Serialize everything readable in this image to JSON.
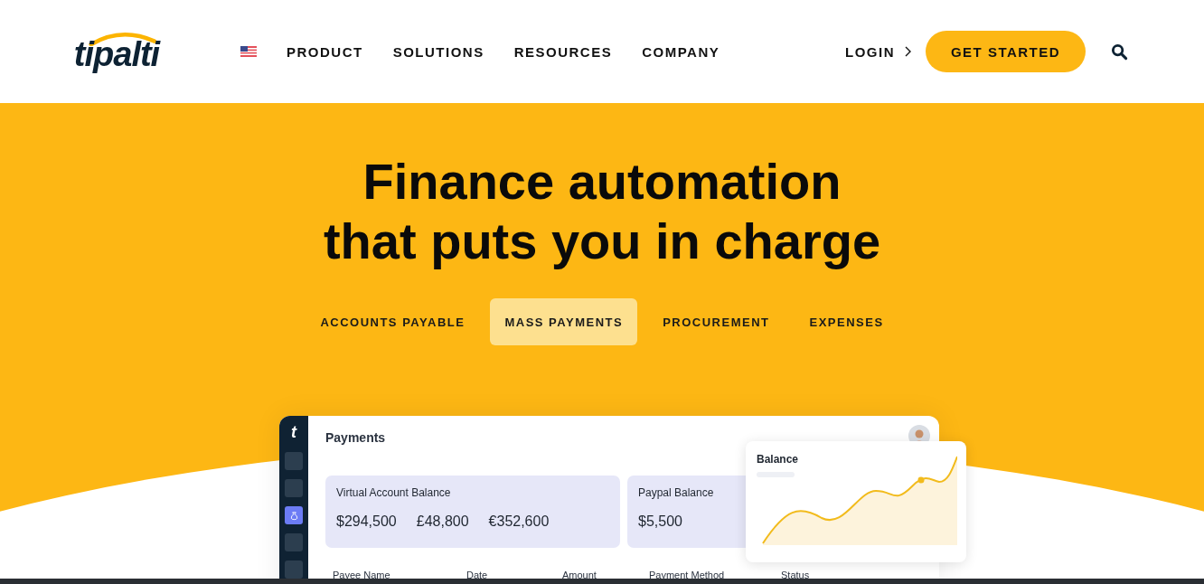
{
  "header": {
    "logo": "tipalti",
    "nav": [
      {
        "label": "PRODUCT"
      },
      {
        "label": "SOLUTIONS"
      },
      {
        "label": "RESOURCES"
      },
      {
        "label": "COMPANY"
      }
    ],
    "login": "LOGIN",
    "cta": "GET STARTED"
  },
  "hero": {
    "title_lines": [
      "Finance automation",
      "that puts you in charge"
    ],
    "tabs": [
      {
        "label": "ACCOUNTS PAYABLE",
        "selected": false
      },
      {
        "label": "MASS PAYMENTS",
        "selected": true
      },
      {
        "label": "PROCUREMENT",
        "selected": false
      },
      {
        "label": "EXPENSES",
        "selected": false
      }
    ]
  },
  "dashboard": {
    "logo": "t",
    "sidebar": [
      {
        "selected": false
      },
      {
        "selected": false
      },
      {
        "selected": true
      },
      {
        "selected": false
      },
      {
        "selected": false
      }
    ],
    "title": "Payments",
    "balances": [
      {
        "label": "Virtual Account Balance",
        "amounts": [
          "$294,500",
          "£48,800",
          "€352,600"
        ]
      },
      {
        "label": "Paypal Balance",
        "amounts": [
          "$5,500"
        ]
      }
    ],
    "columns": [
      "Payee Name",
      "Date",
      "Amount",
      "Payment Method",
      "Status"
    ],
    "popup": {
      "title": "Balance"
    }
  }
}
